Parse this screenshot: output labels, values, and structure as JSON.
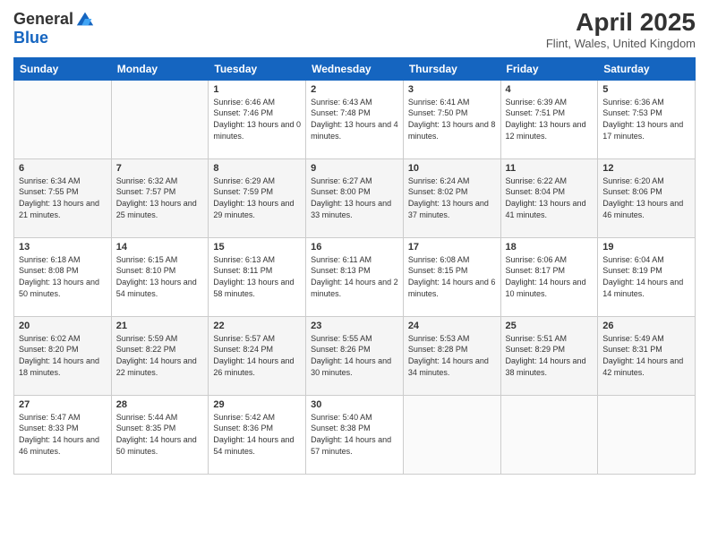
{
  "header": {
    "logo_line1": "General",
    "logo_line2": "Blue",
    "month_title": "April 2025",
    "location": "Flint, Wales, United Kingdom"
  },
  "days_of_week": [
    "Sunday",
    "Monday",
    "Tuesday",
    "Wednesday",
    "Thursday",
    "Friday",
    "Saturday"
  ],
  "weeks": [
    [
      {
        "num": "",
        "info": ""
      },
      {
        "num": "",
        "info": ""
      },
      {
        "num": "1",
        "info": "Sunrise: 6:46 AM\nSunset: 7:46 PM\nDaylight: 13 hours and 0 minutes."
      },
      {
        "num": "2",
        "info": "Sunrise: 6:43 AM\nSunset: 7:48 PM\nDaylight: 13 hours and 4 minutes."
      },
      {
        "num": "3",
        "info": "Sunrise: 6:41 AM\nSunset: 7:50 PM\nDaylight: 13 hours and 8 minutes."
      },
      {
        "num": "4",
        "info": "Sunrise: 6:39 AM\nSunset: 7:51 PM\nDaylight: 13 hours and 12 minutes."
      },
      {
        "num": "5",
        "info": "Sunrise: 6:36 AM\nSunset: 7:53 PM\nDaylight: 13 hours and 17 minutes."
      }
    ],
    [
      {
        "num": "6",
        "info": "Sunrise: 6:34 AM\nSunset: 7:55 PM\nDaylight: 13 hours and 21 minutes."
      },
      {
        "num": "7",
        "info": "Sunrise: 6:32 AM\nSunset: 7:57 PM\nDaylight: 13 hours and 25 minutes."
      },
      {
        "num": "8",
        "info": "Sunrise: 6:29 AM\nSunset: 7:59 PM\nDaylight: 13 hours and 29 minutes."
      },
      {
        "num": "9",
        "info": "Sunrise: 6:27 AM\nSunset: 8:00 PM\nDaylight: 13 hours and 33 minutes."
      },
      {
        "num": "10",
        "info": "Sunrise: 6:24 AM\nSunset: 8:02 PM\nDaylight: 13 hours and 37 minutes."
      },
      {
        "num": "11",
        "info": "Sunrise: 6:22 AM\nSunset: 8:04 PM\nDaylight: 13 hours and 41 minutes."
      },
      {
        "num": "12",
        "info": "Sunrise: 6:20 AM\nSunset: 8:06 PM\nDaylight: 13 hours and 46 minutes."
      }
    ],
    [
      {
        "num": "13",
        "info": "Sunrise: 6:18 AM\nSunset: 8:08 PM\nDaylight: 13 hours and 50 minutes."
      },
      {
        "num": "14",
        "info": "Sunrise: 6:15 AM\nSunset: 8:10 PM\nDaylight: 13 hours and 54 minutes."
      },
      {
        "num": "15",
        "info": "Sunrise: 6:13 AM\nSunset: 8:11 PM\nDaylight: 13 hours and 58 minutes."
      },
      {
        "num": "16",
        "info": "Sunrise: 6:11 AM\nSunset: 8:13 PM\nDaylight: 14 hours and 2 minutes."
      },
      {
        "num": "17",
        "info": "Sunrise: 6:08 AM\nSunset: 8:15 PM\nDaylight: 14 hours and 6 minutes."
      },
      {
        "num": "18",
        "info": "Sunrise: 6:06 AM\nSunset: 8:17 PM\nDaylight: 14 hours and 10 minutes."
      },
      {
        "num": "19",
        "info": "Sunrise: 6:04 AM\nSunset: 8:19 PM\nDaylight: 14 hours and 14 minutes."
      }
    ],
    [
      {
        "num": "20",
        "info": "Sunrise: 6:02 AM\nSunset: 8:20 PM\nDaylight: 14 hours and 18 minutes."
      },
      {
        "num": "21",
        "info": "Sunrise: 5:59 AM\nSunset: 8:22 PM\nDaylight: 14 hours and 22 minutes."
      },
      {
        "num": "22",
        "info": "Sunrise: 5:57 AM\nSunset: 8:24 PM\nDaylight: 14 hours and 26 minutes."
      },
      {
        "num": "23",
        "info": "Sunrise: 5:55 AM\nSunset: 8:26 PM\nDaylight: 14 hours and 30 minutes."
      },
      {
        "num": "24",
        "info": "Sunrise: 5:53 AM\nSunset: 8:28 PM\nDaylight: 14 hours and 34 minutes."
      },
      {
        "num": "25",
        "info": "Sunrise: 5:51 AM\nSunset: 8:29 PM\nDaylight: 14 hours and 38 minutes."
      },
      {
        "num": "26",
        "info": "Sunrise: 5:49 AM\nSunset: 8:31 PM\nDaylight: 14 hours and 42 minutes."
      }
    ],
    [
      {
        "num": "27",
        "info": "Sunrise: 5:47 AM\nSunset: 8:33 PM\nDaylight: 14 hours and 46 minutes."
      },
      {
        "num": "28",
        "info": "Sunrise: 5:44 AM\nSunset: 8:35 PM\nDaylight: 14 hours and 50 minutes."
      },
      {
        "num": "29",
        "info": "Sunrise: 5:42 AM\nSunset: 8:36 PM\nDaylight: 14 hours and 54 minutes."
      },
      {
        "num": "30",
        "info": "Sunrise: 5:40 AM\nSunset: 8:38 PM\nDaylight: 14 hours and 57 minutes."
      },
      {
        "num": "",
        "info": ""
      },
      {
        "num": "",
        "info": ""
      },
      {
        "num": "",
        "info": ""
      }
    ]
  ]
}
